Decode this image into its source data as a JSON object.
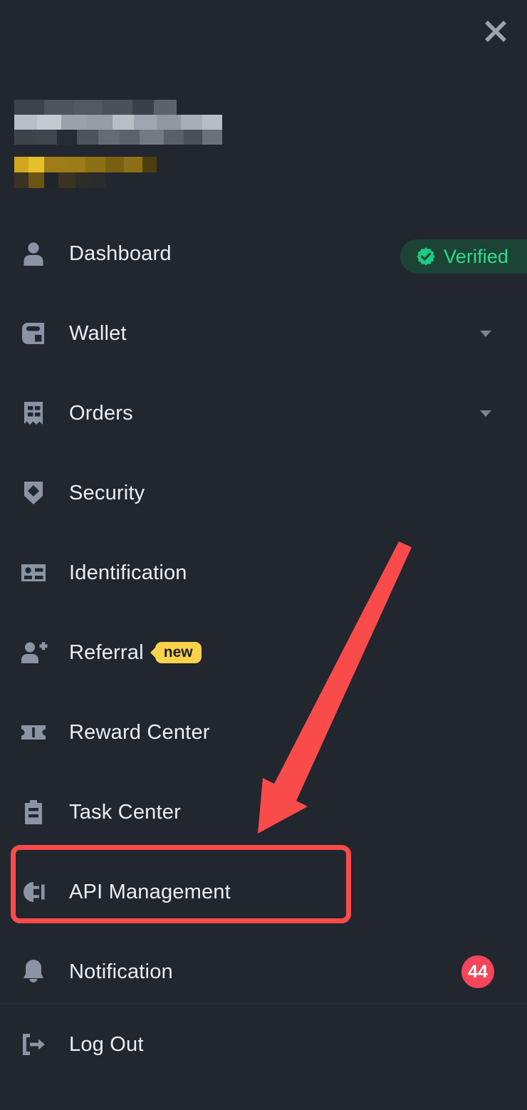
{
  "window": {
    "background_color": "#21262f",
    "close_icon": "close-icon"
  },
  "profile": {
    "name_redacted": true,
    "vip_redacted": true,
    "verified_badge": {
      "label": "Verified",
      "icon": "verified-seal-icon",
      "text_color": "#2ddc8a",
      "background_color": "#1c4436"
    }
  },
  "menu": {
    "items": [
      {
        "label": "Dashboard",
        "icon": "person-icon",
        "chevron": false,
        "badge": null,
        "badge_type": null,
        "highlighted": false
      },
      {
        "label": "Wallet",
        "icon": "wallet-icon",
        "chevron": true,
        "badge": null,
        "badge_type": null,
        "highlighted": false
      },
      {
        "label": "Orders",
        "icon": "receipt-icon",
        "chevron": true,
        "badge": null,
        "badge_type": null,
        "highlighted": false
      },
      {
        "label": "Security",
        "icon": "shield-icon",
        "chevron": false,
        "badge": null,
        "badge_type": null,
        "highlighted": false
      },
      {
        "label": "Identification",
        "icon": "id-card-icon",
        "chevron": false,
        "badge": null,
        "badge_type": null,
        "highlighted": false
      },
      {
        "label": "Referral",
        "icon": "person-add-icon",
        "chevron": false,
        "badge": "new",
        "badge_type": "new",
        "highlighted": false
      },
      {
        "label": "Reward Center",
        "icon": "ticket-icon",
        "chevron": false,
        "badge": null,
        "badge_type": null,
        "highlighted": false
      },
      {
        "label": "Task Center",
        "icon": "clipboard-icon",
        "chevron": false,
        "badge": null,
        "badge_type": null,
        "highlighted": false
      },
      {
        "label": "API Management",
        "icon": "plug-icon",
        "chevron": false,
        "badge": null,
        "badge_type": null,
        "highlighted": true
      },
      {
        "label": "Notification",
        "icon": "bell-icon",
        "chevron": false,
        "badge": "44",
        "badge_type": "count",
        "highlighted": false
      }
    ]
  },
  "logout": {
    "label": "Log Out",
    "icon": "logout-icon"
  },
  "annotation": {
    "color": "#fa4b4b",
    "arrow": "down-left-arrow",
    "highlight_target": "API Management"
  },
  "colors": {
    "background": "#21262f",
    "icon": "#8b94a5",
    "text": "#eceef1",
    "accent_red": "#f4455a",
    "accent_yellow": "#fbd249",
    "accent_green": "#2ddc8a",
    "annotation_red": "#fa4b4b"
  }
}
